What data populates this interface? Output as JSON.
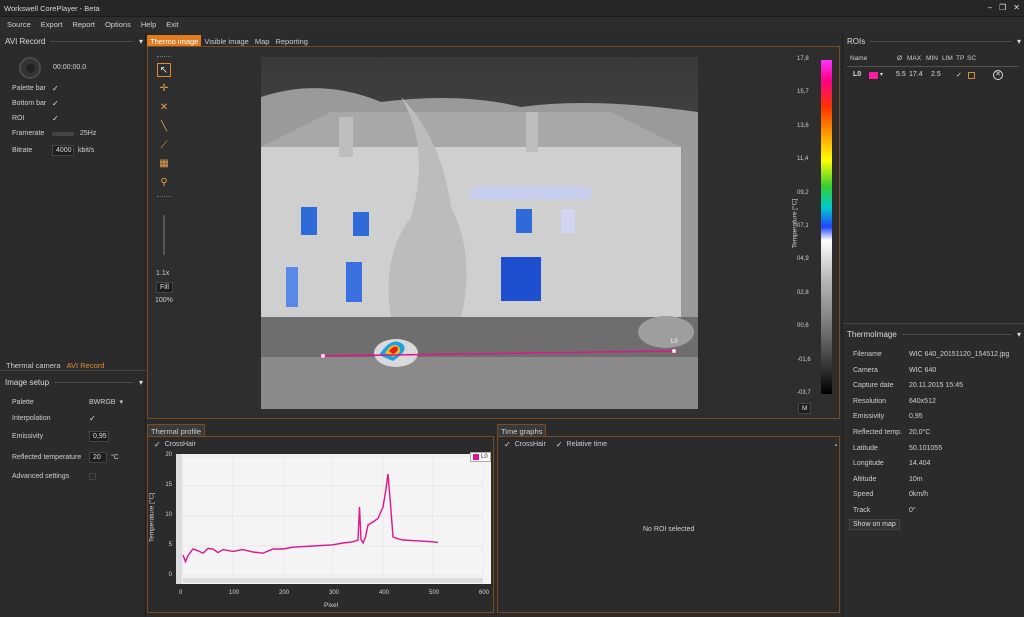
{
  "window": {
    "title": "Workswell CorePlayer - Beta",
    "controls": [
      "–",
      "❐",
      "✕"
    ]
  },
  "menu": [
    "Source",
    "Export",
    "Report",
    "Options",
    "Help",
    "Exit"
  ],
  "avi_record": {
    "header": "AVI Record",
    "time": "00:00:00.0",
    "palette_bar": "Palette bar",
    "bottom_bar": "Bottom bar",
    "roi": "ROI",
    "framerate_label": "Framerate",
    "framerate_value": "25Hz",
    "bitrate_label": "Bitrate",
    "bitrate_value": "4000",
    "bitrate_unit": "kbit/s"
  },
  "left_tabs": [
    "Thermal camera",
    "AVI Record"
  ],
  "image_setup": {
    "header": "Image setup",
    "palette_label": "Palette",
    "palette_value": "BWRGB",
    "interpolation_label": "Interpolation",
    "emissivity_label": "Emissivity",
    "emissivity_value": "0,95",
    "reflected_label": "Reflected temperature",
    "reflected_value": "20",
    "reflected_unit": "°C",
    "advanced_label": "Advanced settings"
  },
  "main_tabs": [
    "Thermo image",
    "Visible image",
    "Map",
    "Reporting"
  ],
  "toolbar": {
    "zoom": "1.1x",
    "fill": "Fill",
    "percent": "100%"
  },
  "scale": {
    "label": "Temperature [°C]",
    "ticks": [
      "17,8",
      "15,7",
      "13,6",
      "11,4",
      "09,2",
      "07,1",
      "04,9",
      "02,8",
      "00,6",
      "-01,6",
      "-03,7"
    ],
    "mode_button": "M"
  },
  "line_label": "L0",
  "rois": {
    "header": "ROIs",
    "columns": [
      "Name",
      "Ø",
      "MAX",
      "MIN",
      "LIM",
      "TP",
      "SC"
    ],
    "rows": [
      {
        "name": "L0",
        "color": "#ff1aa3",
        "avg": "5.5",
        "max": "17.4",
        "min": "2.5"
      }
    ]
  },
  "thermal_profile": {
    "header": "Thermal profile",
    "crosshair": "CrossHair",
    "legend": "L0",
    "ylabel": "Temperature [°C]",
    "xlabel": "Pixel"
  },
  "time_graphs": {
    "header": "Time graphs",
    "crosshair": "CrossHair",
    "relative_time": "Relative time",
    "empty": "No ROI selected"
  },
  "thermoimage": {
    "header": "ThermoImage",
    "items": [
      {
        "key": "Filename",
        "value": "WIC 640_20151120_154512.jpg"
      },
      {
        "key": "Camera",
        "value": "WIC 640"
      },
      {
        "key": "Capture date",
        "value": "20.11.2015 15:45"
      },
      {
        "key": "Resolution",
        "value": "640x512"
      },
      {
        "key": "Emissivity",
        "value": "0,95"
      },
      {
        "key": "Reflected temp.",
        "value": "20,0°C"
      },
      {
        "key": "Latitude",
        "value": "50.101055"
      },
      {
        "key": "Longitude",
        "value": "14.404"
      },
      {
        "key": "Altitude",
        "value": "10m"
      },
      {
        "key": "Speed",
        "value": "0km/h"
      },
      {
        "key": "Track",
        "value": "0°"
      }
    ],
    "show_on_map": "Show on map"
  },
  "chart_data": {
    "type": "line",
    "title": "",
    "xlabel": "Pixel",
    "ylabel": "Temperature [°C]",
    "xlim": [
      0,
      600
    ],
    "ylim": [
      0,
      20
    ],
    "xticks": [
      "0",
      "100",
      "200",
      "300",
      "400",
      "500",
      "600"
    ],
    "yticks": [
      "0",
      "5",
      "10",
      "15",
      "20"
    ],
    "grid": true,
    "legend": "top-right",
    "series": [
      {
        "name": "L0",
        "color": "#e0148c",
        "x": [
          0,
          5,
          10,
          20,
          30,
          40,
          50,
          60,
          70,
          80,
          100,
          120,
          140,
          160,
          180,
          200,
          220,
          240,
          260,
          280,
          300,
          320,
          340,
          350,
          353,
          356,
          360,
          365,
          370,
          380,
          390,
          400,
          405,
          410,
          415,
          420,
          430,
          440,
          460,
          480,
          500,
          510
        ],
        "y": [
          3.5,
          2.4,
          3.4,
          4.5,
          4.2,
          3.8,
          4.6,
          4.5,
          3.9,
          4.4,
          4.1,
          4.4,
          4.0,
          3.8,
          4.5,
          4.5,
          4.8,
          4.9,
          5.0,
          5.1,
          5.2,
          5.5,
          5.7,
          6.0,
          11.5,
          6.1,
          5.5,
          6.5,
          8.5,
          9.0,
          9.6,
          11.5,
          14.0,
          17.0,
          12.0,
          6.5,
          6.2,
          6.0,
          5.9,
          5.8,
          5.7,
          5.6
        ]
      }
    ]
  }
}
